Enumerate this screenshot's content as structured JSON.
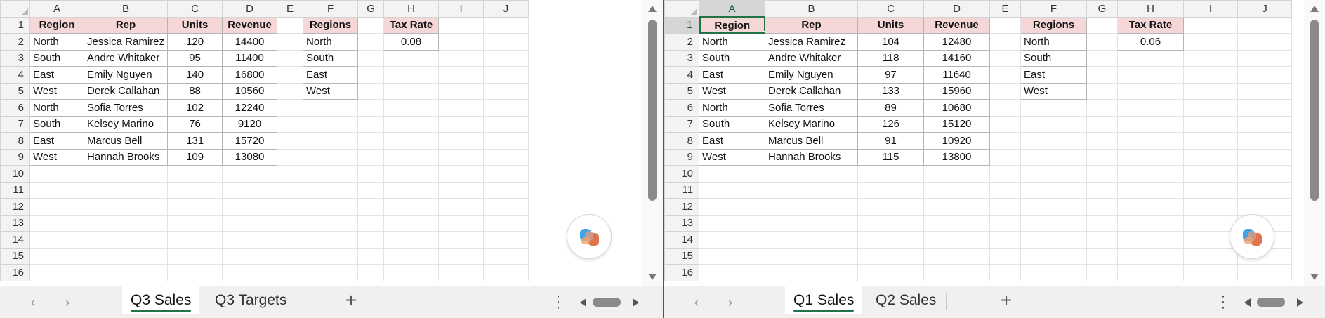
{
  "columns": [
    "A",
    "B",
    "C",
    "D",
    "E",
    "F",
    "G",
    "H",
    "I",
    "J"
  ],
  "rows": [
    "1",
    "2",
    "3",
    "4",
    "5",
    "6",
    "7",
    "8",
    "9",
    "10",
    "11",
    "12",
    "13",
    "14",
    "15",
    "16"
  ],
  "left": {
    "header": {
      "region": "Region",
      "rep": "Rep",
      "units": "Units",
      "revenue": "Revenue",
      "regions": "Regions",
      "tax_rate": "Tax Rate"
    },
    "tax_rate_value": "0.08",
    "regions_list": [
      "North",
      "South",
      "East",
      "West"
    ],
    "data": [
      {
        "region": "North",
        "rep": "Jessica Ramirez",
        "units": "120",
        "revenue": "14400"
      },
      {
        "region": "South",
        "rep": "Andre Whitaker",
        "units": "95",
        "revenue": "11400"
      },
      {
        "region": "East",
        "rep": "Emily Nguyen",
        "units": "140",
        "revenue": "16800"
      },
      {
        "region": "West",
        "rep": "Derek Callahan",
        "units": "88",
        "revenue": "10560"
      },
      {
        "region": "North",
        "rep": "Sofia Torres",
        "units": "102",
        "revenue": "12240"
      },
      {
        "region": "South",
        "rep": "Kelsey Marino",
        "units": "76",
        "revenue": "9120"
      },
      {
        "region": "East",
        "rep": "Marcus Bell",
        "units": "131",
        "revenue": "15720"
      },
      {
        "region": "West",
        "rep": "Hannah Brooks",
        "units": "109",
        "revenue": "13080"
      }
    ],
    "tabs": {
      "active": "Q3 Sales",
      "other": "Q3 Targets"
    }
  },
  "right": {
    "header": {
      "region": "Region",
      "rep": "Rep",
      "units": "Units",
      "revenue": "Revenue",
      "regions": "Regions",
      "tax_rate": "Tax Rate"
    },
    "tax_rate_value": "0.06",
    "regions_list": [
      "North",
      "South",
      "East",
      "West"
    ],
    "data": [
      {
        "region": "North",
        "rep": "Jessica Ramirez",
        "units": "104",
        "revenue": "12480"
      },
      {
        "region": "South",
        "rep": "Andre Whitaker",
        "units": "118",
        "revenue": "14160"
      },
      {
        "region": "East",
        "rep": "Emily Nguyen",
        "units": "97",
        "revenue": "11640"
      },
      {
        "region": "West",
        "rep": "Derek Callahan",
        "units": "133",
        "revenue": "15960"
      },
      {
        "region": "North",
        "rep": "Sofia Torres",
        "units": "89",
        "revenue": "10680"
      },
      {
        "region": "South",
        "rep": "Kelsey Marino",
        "units": "126",
        "revenue": "15120"
      },
      {
        "region": "East",
        "rep": "Marcus Bell",
        "units": "91",
        "revenue": "10920"
      },
      {
        "region": "West",
        "rep": "Hannah Brooks",
        "units": "115",
        "revenue": "13800"
      }
    ],
    "tabs": {
      "active": "Q1 Sales",
      "other": "Q2 Sales"
    }
  },
  "icons": {
    "prev": "chevron-left-icon",
    "next": "chevron-right-icon",
    "add": "plus-icon",
    "more": "more-vertical-icon",
    "copilot": "copilot-icon"
  },
  "colors": {
    "header_fill": "#f4d7d6",
    "accent": "#217346"
  }
}
